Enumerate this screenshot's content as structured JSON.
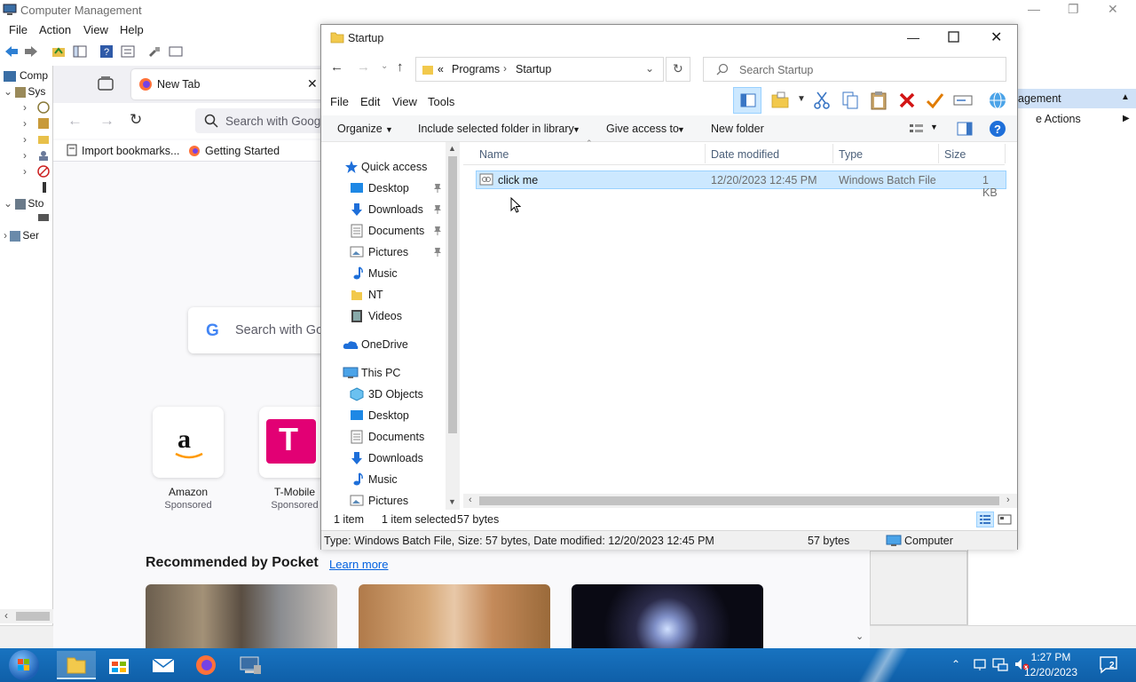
{
  "cm": {
    "title": "Computer Management",
    "menu": [
      "File",
      "Action",
      "View",
      "Help"
    ],
    "tree": [
      "Comp",
      "Sys",
      "Sto",
      "Ser"
    ],
    "actions_header": "agement",
    "actions_item": "e Actions"
  },
  "firefox": {
    "tab_title": "New Tab",
    "url_placeholder": "Search with Goog",
    "bookmarks": [
      "Import bookmarks...",
      "Getting Started"
    ],
    "search_placeholder": "Search with Go",
    "tiles": [
      {
        "label": "Amazon",
        "sub": "Sponsored"
      },
      {
        "label": "T-Mobile",
        "sub": "Sponsored"
      }
    ],
    "pocket_heading": "Recommended by Pocket",
    "pocket_link": "Learn more"
  },
  "explorer": {
    "title": "Startup",
    "breadcrumb": {
      "sep": "«",
      "parts": [
        "Programs",
        "Startup"
      ]
    },
    "search_placeholder": "Search Startup",
    "menu": [
      "File",
      "Edit",
      "View",
      "Tools"
    ],
    "commands": {
      "organize": "Organize",
      "include": "Include selected folder in library",
      "give_access": "Give access to",
      "new_folder": "New folder"
    },
    "nav": {
      "quick_access": "Quick access",
      "quick_items": [
        {
          "label": "Desktop",
          "pinned": true
        },
        {
          "label": "Downloads",
          "pinned": true
        },
        {
          "label": "Documents",
          "pinned": true
        },
        {
          "label": "Pictures",
          "pinned": true
        },
        {
          "label": "Music",
          "pinned": false
        },
        {
          "label": "NT",
          "pinned": false
        },
        {
          "label": "Videos",
          "pinned": false
        }
      ],
      "onedrive": "OneDrive",
      "this_pc": "This PC",
      "pc_items": [
        "3D Objects",
        "Desktop",
        "Documents",
        "Downloads",
        "Music",
        "Pictures"
      ]
    },
    "columns": {
      "name": "Name",
      "date": "Date modified",
      "type": "Type",
      "size": "Size"
    },
    "files": [
      {
        "name": "click me",
        "date": "12/20/2023 12:45 PM",
        "type": "Windows Batch File",
        "size": "1 KB"
      }
    ],
    "status": {
      "count": "1 item",
      "selected": "1 item selected",
      "bytes": "57 bytes"
    },
    "details": {
      "info": "Type: Windows Batch File, Size: 57 bytes, Date modified: 12/20/2023 12:45 PM",
      "size": "57 bytes",
      "location": "Computer"
    }
  },
  "taskbar": {
    "time": "1:27 PM",
    "date": "12/20/2023",
    "notification_count": "2"
  }
}
